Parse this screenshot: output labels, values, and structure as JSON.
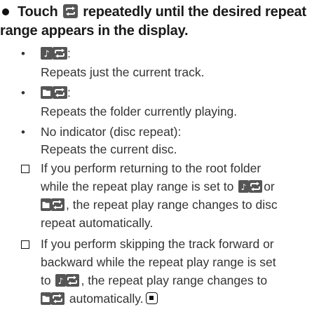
{
  "heading": {
    "part1": "Touch",
    "part2": "repeatedly until the desired repeat range appears in the display.",
    "icon": "repeat-icon"
  },
  "options": [
    {
      "icon": "track-repeat-icon",
      "suffix": ":",
      "description": "Repeats just the current track."
    },
    {
      "icon": "folder-repeat-icon",
      "suffix": ":",
      "description": "Repeats the folder currently playing."
    },
    {
      "label": "No indicator (disc repeat):",
      "description": "Repeats the current disc."
    }
  ],
  "notes": [
    {
      "line1": "If you perform returning to the root folder",
      "line2_a": "while the repeat play range is set to",
      "line2_b": "or",
      "line3_b": ", the repeat play range changes to disc",
      "line4": "repeat automatically."
    },
    {
      "line1": "If you perform skipping the track forward or",
      "line2": "backward while the repeat play range is set",
      "line3_a": "to",
      "line3_b": ", the repeat play range changes to",
      "line4_b": "automatically."
    }
  ],
  "colors": {
    "icon_bg": "#555555",
    "icon_fg": "#ffffff",
    "text": "#333333"
  }
}
